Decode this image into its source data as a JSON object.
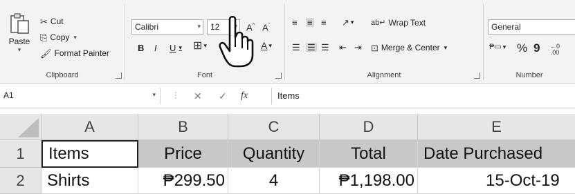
{
  "clipboard": {
    "paste_label": "Paste",
    "cut_label": "Cut",
    "copy_label": "Copy",
    "format_painter_label": "Format Painter",
    "group_label": "Clipboard"
  },
  "font": {
    "font_name": "Calibri",
    "font_size": "12",
    "group_label": "Font",
    "bold": "B",
    "italic": "I",
    "underline": "U"
  },
  "alignment": {
    "wrap_text_label": "Wrap Text",
    "merge_center_label": "Merge & Center",
    "group_label": "Alignment"
  },
  "number": {
    "format_value": "General",
    "percent": "%",
    "comma": "9",
    "group_label": "Number"
  },
  "formula_bar": {
    "name_box": "A1",
    "fx": "fx",
    "content": "Items"
  },
  "sheet": {
    "columns": [
      "A",
      "B",
      "C",
      "D",
      "E"
    ],
    "rows": [
      "1",
      "2"
    ],
    "cells": [
      [
        "Items",
        "Price",
        "Quantity",
        "Total",
        "Date Purchased"
      ],
      [
        "Shirts",
        "₱299.50",
        "4",
        "₱1,198.00",
        "15-Oct-19"
      ]
    ]
  },
  "colors": {
    "header_fill": "#c8c8c8",
    "ribbon_bg": "#f3f3f3"
  },
  "icons": [
    "paste-icon",
    "cut-icon",
    "copy-icon",
    "format-painter-icon",
    "hand-cursor-icon"
  ]
}
